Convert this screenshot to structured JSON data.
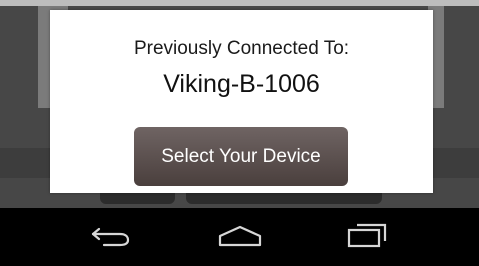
{
  "dialog": {
    "label": "Previously Connected To:",
    "device_name": "Viking-B-1006",
    "select_button_label": "Select Your Device"
  },
  "navbar": {
    "back_icon": "back-icon",
    "home_icon": "home-icon",
    "recents_icon": "recents-icon"
  },
  "colors": {
    "nav_background": "#000000",
    "button_background": "#5a4f4d",
    "dialog_background": "#ffffff"
  }
}
